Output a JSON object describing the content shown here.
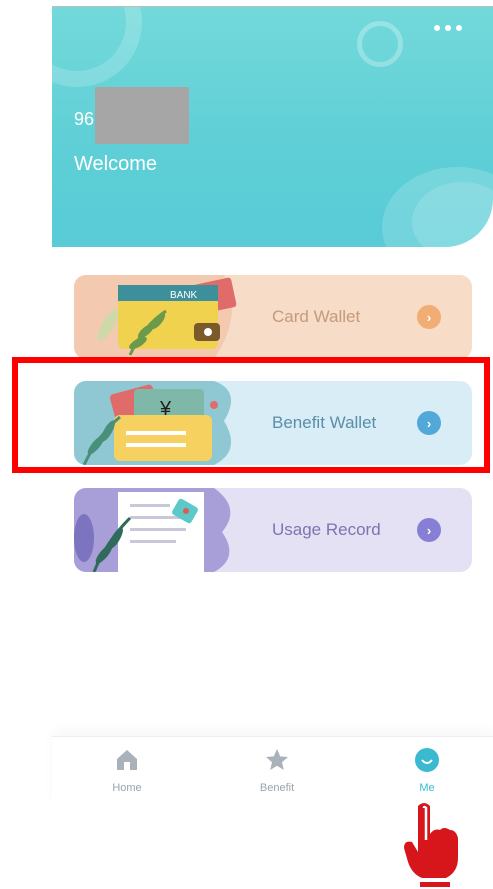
{
  "header": {
    "user_id_prefix": "96",
    "welcome": "Welcome"
  },
  "cards": [
    {
      "label": "Card Wallet",
      "art_text": "BANK",
      "accent": "#f1ad73"
    },
    {
      "label": "Benefit Wallet",
      "art_text": "¥",
      "accent": "#52a8d8"
    },
    {
      "label": "Usage Record",
      "accent": "#877fd6"
    }
  ],
  "tabs": [
    {
      "label": "Home",
      "icon": "home-icon"
    },
    {
      "label": "Benefit",
      "icon": "star-icon"
    },
    {
      "label": "Me",
      "icon": "smile-icon",
      "active": true
    }
  ],
  "colors": {
    "header": "#5ecfd6",
    "active_tab": "#3ab9d0",
    "highlight": "#ff0000",
    "pointer_hand": "#d7161c"
  }
}
